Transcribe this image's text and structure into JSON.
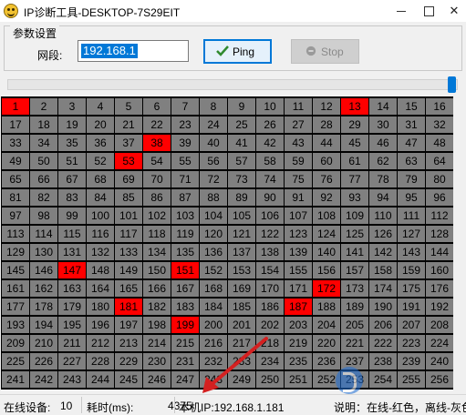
{
  "window": {
    "title": "IP诊断工具-DESKTOP-7S29EIT"
  },
  "params": {
    "group_title": "参数设置",
    "segment_label": "网段:",
    "segment_value": "192.168.1",
    "ping_label": "Ping",
    "stop_label": "Stop"
  },
  "online_ips": [
    1,
    13,
    38,
    53,
    147,
    151,
    172,
    181,
    187,
    199
  ],
  "grid": {
    "first": 1,
    "last": 256,
    "columns": 16
  },
  "colors": {
    "online": "#ff0000",
    "offline": "#808080",
    "grid_border": "#000000"
  },
  "status": {
    "online_label": "在线设备:",
    "online_count": "10",
    "time_label": "耗时(ms):",
    "time_value": "4375",
    "local_ip": "本机IP:192.168.1.181",
    "legend": "说明：在线-红色，离线-灰色"
  }
}
